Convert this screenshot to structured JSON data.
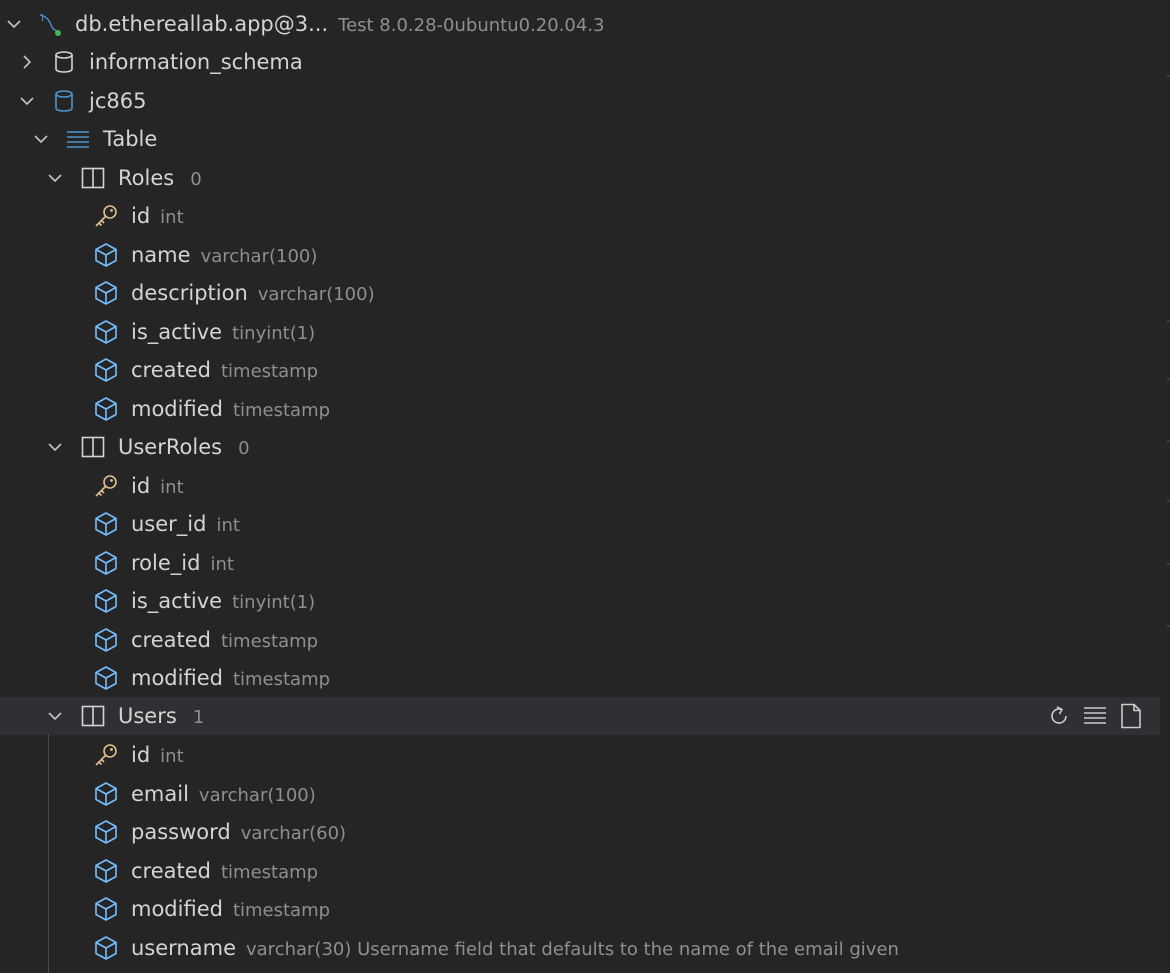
{
  "connection": {
    "name": "db.ethereallab.app@3...",
    "description": "Test 8.0.28-0ubuntu0.20.04.3"
  },
  "databases": [
    {
      "name": "information_schema"
    },
    {
      "name": "jc865"
    }
  ],
  "table_group": {
    "label": "Table"
  },
  "tables": [
    {
      "name": "Roles",
      "count": "0",
      "columns": [
        {
          "name": "id",
          "type": "int",
          "key": true
        },
        {
          "name": "name",
          "type": "varchar(100)"
        },
        {
          "name": "description",
          "type": "varchar(100)"
        },
        {
          "name": "is_active",
          "type": "tinyint(1)"
        },
        {
          "name": "created",
          "type": "timestamp"
        },
        {
          "name": "modified",
          "type": "timestamp"
        }
      ]
    },
    {
      "name": "UserRoles",
      "count": "0",
      "columns": [
        {
          "name": "id",
          "type": "int",
          "key": true
        },
        {
          "name": "user_id",
          "type": "int"
        },
        {
          "name": "role_id",
          "type": "int"
        },
        {
          "name": "is_active",
          "type": "tinyint(1)"
        },
        {
          "name": "created",
          "type": "timestamp"
        },
        {
          "name": "modified",
          "type": "timestamp"
        }
      ]
    },
    {
      "name": "Users",
      "count": "1",
      "columns": [
        {
          "name": "id",
          "type": "int",
          "key": true
        },
        {
          "name": "email",
          "type": "varchar(100)"
        },
        {
          "name": "password",
          "type": "varchar(60)"
        },
        {
          "name": "created",
          "type": "timestamp"
        },
        {
          "name": "modified",
          "type": "timestamp"
        },
        {
          "name": "username",
          "type": "varchar(30) Username field that defaults to the name of the email given"
        }
      ]
    }
  ],
  "hover_actions": [
    {
      "icon": "refresh-icon"
    },
    {
      "icon": "list-icon"
    },
    {
      "icon": "new-file-icon"
    }
  ],
  "colors": {
    "background": "#252526",
    "hover_row": "#2f3033",
    "text": "#d4d4d4",
    "description": "#8f8f8f",
    "db_icon_blue": "#4e94ce",
    "column_icon_blue": "#75beff",
    "key_icon_gold": "#e2c08d",
    "connection_status_green": "#3fb950"
  }
}
